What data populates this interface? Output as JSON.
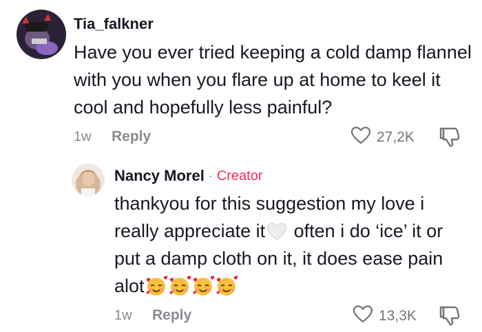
{
  "comments": [
    {
      "username": "Tia_falkner",
      "text": "Have you ever tried keeping a cold damp flannel with you when you flare up at home to keel it cool and hopefully less painful?",
      "time": "1w",
      "reply_label": "Reply",
      "likes": "27,2K"
    }
  ],
  "reply": {
    "username": "Nancy Morel",
    "separator": "·",
    "badge": "Creator",
    "text_part1": "thankyou for this suggestion my love i really appreciate it",
    "text_part2": "often i do ‘ice’ it or put a damp cloth on it, it does ease pain alot",
    "inline_icons": [
      "white-heart-emoji",
      "smiling-face-with-hearts-emoji"
    ],
    "time": "1w",
    "reply_label": "Reply",
    "likes": "13,3K"
  },
  "colors": {
    "text": "#161823",
    "muted": "#8a8b91",
    "creator_badge": "#fe2c55"
  }
}
